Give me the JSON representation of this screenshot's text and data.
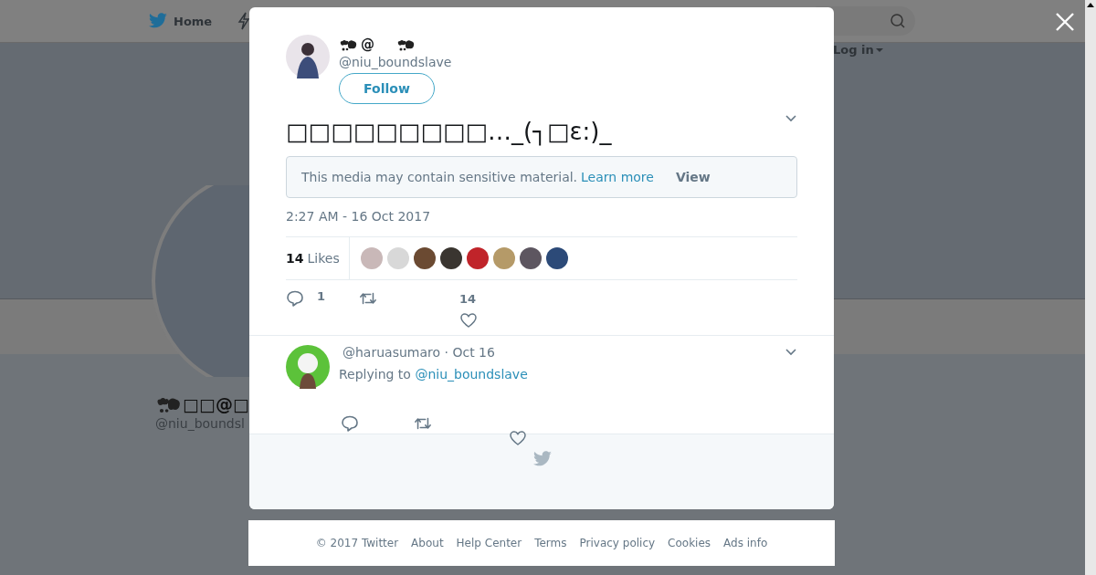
{
  "nav": {
    "home": "Home",
    "login": "Log in"
  },
  "profile": {
    "name": "□□@□",
    "handle": "@niu_boundsl"
  },
  "tweet": {
    "name": "@",
    "handle": "@niu_boundslave",
    "follow": "Follow",
    "text": "□□□□□□□□□…_(┐□ε:)_",
    "sensitive": {
      "message": "This media may contain sensitive material.",
      "link": "Learn more",
      "button": "View"
    },
    "timestamp": "2:27 AM - 16 Oct 2017",
    "likes": {
      "count": "14",
      "label": "Likes",
      "avatars": [
        {
          "color": "#c9b8b8"
        },
        {
          "color": "#d8d8d8"
        },
        {
          "color": "#6b4a32"
        },
        {
          "color": "#3a3530"
        },
        {
          "color": "#c0242a"
        },
        {
          "color": "#b59a68"
        },
        {
          "color": "#5d5660"
        },
        {
          "color": "#2c4a78"
        }
      ]
    },
    "actions": {
      "replies": "1",
      "likes": "14"
    }
  },
  "reply": {
    "handle": "@haruasumaro",
    "date": "· Oct 16",
    "replying_label": "Replying to",
    "replying_to": "@niu_boundslave"
  },
  "footer": [
    "© 2017 Twitter",
    "About",
    "Help Center",
    "Terms",
    "Privacy policy",
    "Cookies",
    "Ads info"
  ]
}
